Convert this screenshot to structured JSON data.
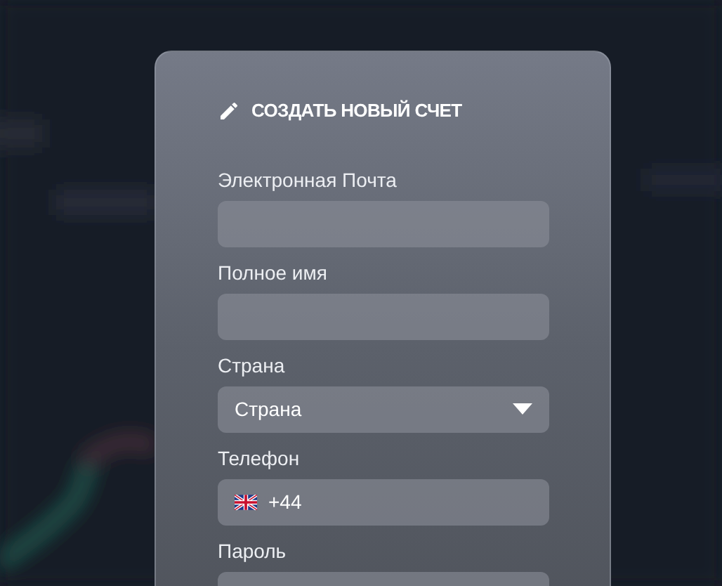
{
  "form": {
    "title": "СОЗДАТЬ НОВЫЙ СЧЕТ",
    "fields": [
      {
        "kind": "text",
        "label": "Электронная Почта"
      },
      {
        "kind": "text",
        "label": "Полное имя"
      },
      {
        "kind": "select",
        "label": "Страна",
        "value": "Страна"
      },
      {
        "kind": "phone",
        "label": "Телефон",
        "value": "+44"
      },
      {
        "kind": "text",
        "label": "Пароль"
      }
    ]
  }
}
